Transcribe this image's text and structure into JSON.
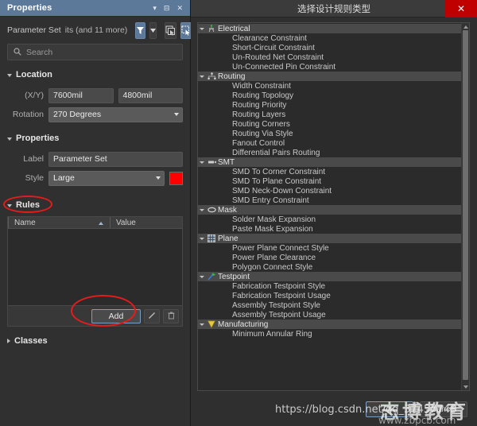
{
  "properties_panel": {
    "title": "Properties",
    "titlebar_icons": [
      "chevron-down-icon",
      "dock-icon",
      "close-icon"
    ],
    "object_label": "Parameter Set",
    "object_count_label": "its (and 11 more)",
    "toolbar": {
      "filter_label": "filter-icon",
      "filter_dropdown_label": "chevron-down-icon",
      "select_all_label": "select-all-icon",
      "select_touching_label": "select-touching-icon"
    },
    "search": {
      "placeholder": "Search",
      "value": ""
    },
    "sections": {
      "location": {
        "title": "Location",
        "expanded": true,
        "xy_label": "(X/Y)",
        "x_value": "7600mil",
        "y_value": "4800mil",
        "rotation_label": "Rotation",
        "rotation_value": "270 Degrees"
      },
      "properties": {
        "title": "Properties",
        "expanded": true,
        "label_label": "Label",
        "label_value": "Parameter Set",
        "style_label": "Style",
        "style_value": "Large",
        "color_value": "#ff0000"
      },
      "rules": {
        "title": "Rules",
        "expanded": true,
        "columns": [
          "Name",
          "Value"
        ],
        "sorted_column": "Name",
        "rows": [],
        "add_button": "Add",
        "edit_button": "edit-icon",
        "delete_button": "delete-icon"
      },
      "classes": {
        "title": "Classes",
        "expanded": false
      }
    }
  },
  "dialog": {
    "title": "选择设计规则类型",
    "close_label": "✕",
    "tree": [
      {
        "label": "Electrical",
        "type": "group",
        "icon": "electrical-icon",
        "expanded": true,
        "children": [
          "Clearance Constraint",
          "Short-Circuit Constraint",
          "Un-Routed Net Constraint",
          "Un-Connected Pin Constraint"
        ]
      },
      {
        "label": "Routing",
        "type": "group",
        "icon": "routing-icon",
        "expanded": true,
        "children": [
          "Width Constraint",
          "Routing Topology",
          "Routing Priority",
          "Routing Layers",
          "Routing Corners",
          "Routing Via Style",
          "Fanout Control",
          "Differential Pairs Routing"
        ]
      },
      {
        "label": "SMT",
        "type": "group",
        "icon": "smt-icon",
        "expanded": true,
        "children": [
          "SMD To Corner Constraint",
          "SMD To Plane Constraint",
          "SMD Neck-Down Constraint",
          "SMD Entry Constraint"
        ]
      },
      {
        "label": "Mask",
        "type": "group",
        "icon": "mask-icon",
        "expanded": true,
        "children": [
          "Solder Mask Expansion",
          "Paste Mask Expansion"
        ]
      },
      {
        "label": "Plane",
        "type": "group",
        "icon": "plane-icon",
        "expanded": true,
        "children": [
          "Power Plane Connect Style",
          "Power Plane Clearance",
          "Polygon Connect Style"
        ]
      },
      {
        "label": "Testpoint",
        "type": "group",
        "icon": "testpoint-icon",
        "expanded": true,
        "children": [
          "Fabrication Testpoint Style",
          "Fabrication Testpoint Usage",
          "Assembly Testpoint Style",
          "Assembly Testpoint Usage"
        ]
      },
      {
        "label": "Manufacturing",
        "type": "group",
        "icon": "manufacturing-icon",
        "expanded": true,
        "children": [
          "Minimum Annular Ring"
        ]
      }
    ],
    "scrollbar": {
      "up_arrow": "scroll-up-icon",
      "down_arrow": "scroll-down-icon"
    },
    "footer": {
      "ok_label": "OK",
      "cancel_label": "Cancel"
    }
  },
  "annotations": {
    "arrow_color": "#e81b1b",
    "ellipse_color": "#e81b1b",
    "highlights": [
      "rules-section-title",
      "add-button",
      "dialog-title-arrow"
    ]
  },
  "watermarks": {
    "url": "https://blog.csdn.net/qq_37457748",
    "brand_cn": "志博教育",
    "brand_site": "www.zbpcb.com"
  }
}
